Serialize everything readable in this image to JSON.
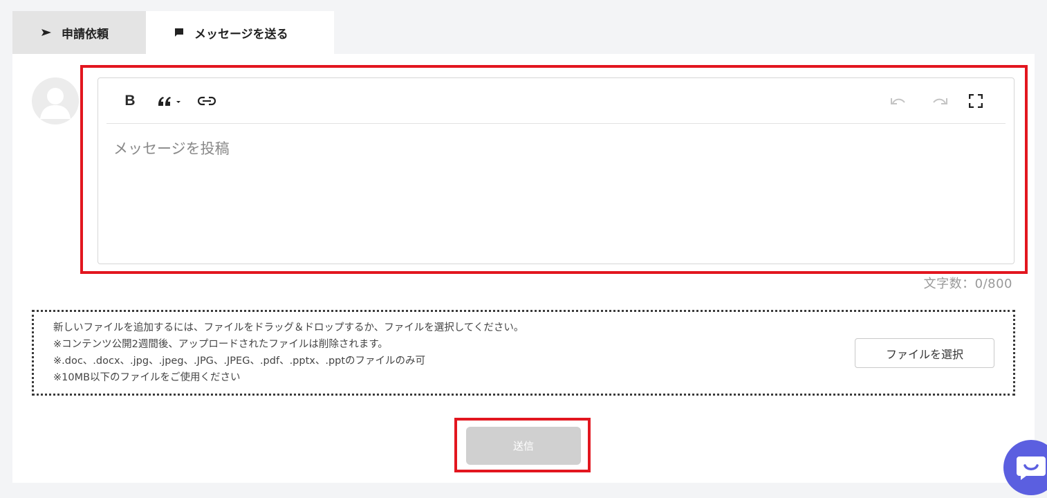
{
  "tabs": [
    {
      "label": "申請依頼",
      "icon": "send-arrow-icon",
      "active": false
    },
    {
      "label": "メッセージを送る",
      "icon": "message-icon",
      "active": true
    }
  ],
  "editor": {
    "toolbar": {
      "bold_label": "B",
      "quote_icon": "quote-dropdown-icon",
      "link_icon": "link-icon",
      "undo_icon": "undo-icon",
      "redo_icon": "redo-icon",
      "fullscreen_icon": "fullscreen-icon"
    },
    "placeholder": "メッセージを投稿",
    "value": ""
  },
  "char_count": "文字数：0/800",
  "upload": {
    "instructions": [
      "新しいファイルを追加するには、ファイルをドラッグ＆ドロップするか、ファイルを選択してください。",
      "※コンテンツ公開2週間後、アップロードされたファイルは削除されます。",
      "※.doc、.docx、.jpg、.jpeg、.JPG、.JPEG、.pdf、.pptx、.pptのファイルのみ可",
      "※10MB以下のファイルをご使用ください"
    ],
    "select_button_label": "ファイルを選択"
  },
  "send_button_label": "送信",
  "colors": {
    "highlight": "#e2161f",
    "chat_bubble": "#5b5fe0",
    "send_disabled": "#d0d0d0"
  }
}
